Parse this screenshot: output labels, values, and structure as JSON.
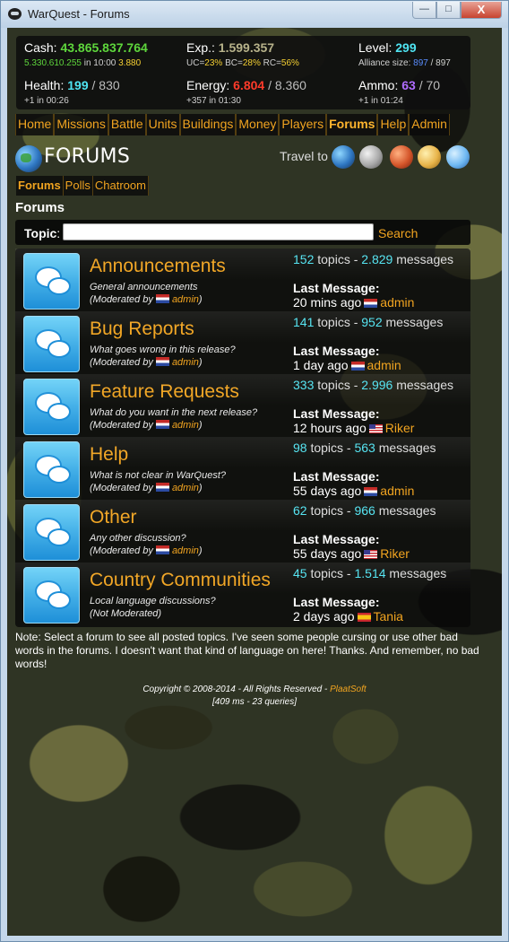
{
  "window": {
    "title": "WarQuest - Forums",
    "minimize": "—",
    "maximize": "□",
    "close": "X"
  },
  "stats": {
    "cash": {
      "label": "Cash:",
      "value": "43.865.837.764",
      "income": "5.330.610.255",
      "income_time": "in 10:00",
      "income_extra": "3.880"
    },
    "exp": {
      "label": "Exp.:",
      "value": "1.599.357",
      "uc_label": "UC=",
      "uc": "23%",
      "bc_label": "BC=",
      "bc": "28%",
      "rc_label": "RC=",
      "rc": "56%"
    },
    "level": {
      "label": "Level:",
      "value": "299",
      "alliance_label": "Alliance size:",
      "alliance_current": "897",
      "alliance_total": "/ 897"
    },
    "health": {
      "label": "Health:",
      "value": "199",
      "max": "/ 830",
      "regen": "+1 in 00:26"
    },
    "energy": {
      "label": "Energy:",
      "value": "6.804",
      "max": "/ 8.360",
      "regen": "+357 in 01:30"
    },
    "ammo": {
      "label": "Ammo:",
      "value": "63",
      "max": "/ 70",
      "regen": "+1 in 01:24"
    }
  },
  "nav": {
    "items": [
      {
        "label": "Home"
      },
      {
        "label": "Missions"
      },
      {
        "label": "Battle"
      },
      {
        "label": "Units"
      },
      {
        "label": "Buildings"
      },
      {
        "label": "Money"
      },
      {
        "label": "Players"
      },
      {
        "label": "Forums"
      },
      {
        "label": "Help"
      },
      {
        "label": "Admin"
      }
    ]
  },
  "page": {
    "heading": "FORUMS",
    "travel_label": "Travel to",
    "section_title": "Forums"
  },
  "subtabs": [
    {
      "label": "Forums"
    },
    {
      "label": "Polls"
    },
    {
      "label": "Chatroom"
    }
  ],
  "topic_search": {
    "label": "Topic",
    "colon": ":",
    "value": "",
    "button": "Search"
  },
  "forums": [
    {
      "name": "Announcements",
      "description": "General announcements",
      "mod_prefix": "(Moderated by",
      "mod_flag": "nl",
      "moderator": "admin",
      "mod_suffix": ")",
      "topics": "152",
      "topics_label": "topics -",
      "messages": "2.829",
      "messages_label": "messages",
      "last_label": "Last Message:",
      "last_time": "20 mins ago",
      "last_flag": "nl",
      "last_user": "admin"
    },
    {
      "name": "Bug Reports",
      "description": "What goes wrong in this release?",
      "mod_prefix": "(Moderated by",
      "mod_flag": "nl",
      "moderator": "admin",
      "mod_suffix": ")",
      "topics": "141",
      "topics_label": "topics -",
      "messages": "952",
      "messages_label": "messages",
      "last_label": "Last Message:",
      "last_time": "1 day ago",
      "last_flag": "nl",
      "last_user": "admin"
    },
    {
      "name": "Feature Requests",
      "description": "What do you want in the next release?",
      "mod_prefix": "(Moderated by",
      "mod_flag": "nl",
      "moderator": "admin",
      "mod_suffix": ")",
      "topics": "333",
      "topics_label": "topics -",
      "messages": "2.996",
      "messages_label": "messages",
      "last_label": "Last Message:",
      "last_time": "12 hours ago",
      "last_flag": "us",
      "last_user": "Riker"
    },
    {
      "name": "Help",
      "description": "What is not clear in WarQuest?",
      "mod_prefix": "(Moderated by",
      "mod_flag": "nl",
      "moderator": "admin",
      "mod_suffix": ")",
      "topics": "98",
      "topics_label": "topics -",
      "messages": "563",
      "messages_label": "messages",
      "last_label": "Last Message:",
      "last_time": "55 days ago",
      "last_flag": "nl",
      "last_user": "admin"
    },
    {
      "name": "Other",
      "description": "Any other discussion?",
      "mod_prefix": "(Moderated by",
      "mod_flag": "nl",
      "moderator": "admin",
      "mod_suffix": ")",
      "topics": "62",
      "topics_label": "topics -",
      "messages": "966",
      "messages_label": "messages",
      "last_label": "Last Message:",
      "last_time": "55 days ago",
      "last_flag": "us",
      "last_user": "Riker"
    },
    {
      "name": "Country Communities",
      "description": "Local language discussions?",
      "mod_prefix": "(Not Moderated)",
      "mod_flag": "",
      "moderator": "",
      "mod_suffix": "",
      "topics": "45",
      "topics_label": "topics -",
      "messages": "1.514",
      "messages_label": "messages",
      "last_label": "Last Message:",
      "last_time": "2 days ago",
      "last_flag": "es",
      "last_user": "Tania"
    }
  ],
  "note": "Note: Select a forum to see all posted topics. I've seen some people cursing or use other bad words in the forums. I doesn't want that kind of language on here! Thanks. And remember, no bad words!",
  "footer": {
    "copyright": "Copyright © 2008-2014 - All Rights Reserved -",
    "company": "PlaatSoft",
    "timing": "[409 ms - 23 queries]"
  },
  "colors": {
    "accent": "#f1a420",
    "cash": "#5ed63c",
    "level": "#4fe4f2",
    "energy": "#ff3b2a",
    "ammo": "#b06cff"
  }
}
